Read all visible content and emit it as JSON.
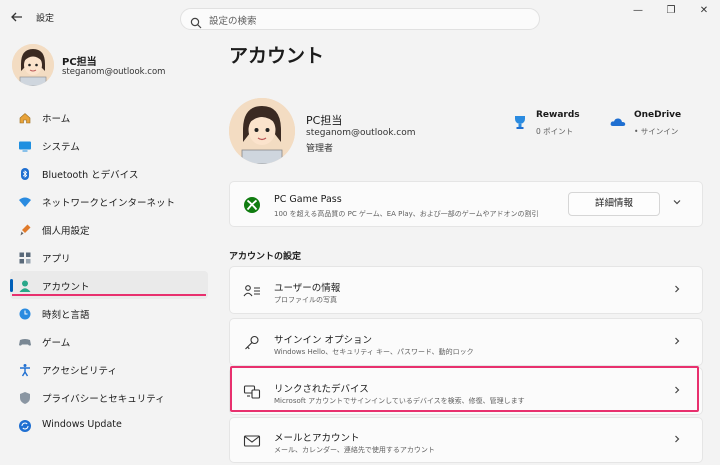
{
  "window": {
    "back_icon": "back-arrow-icon",
    "title": "設定",
    "search_placeholder": "設定の検索",
    "minimize": "—",
    "maximize": "❐",
    "close": "✕"
  },
  "profile": {
    "name": "PC担当",
    "email": "steganom@outlook.com"
  },
  "sidebar": {
    "items": [
      {
        "label": "ホーム",
        "icon": "home-icon"
      },
      {
        "label": "システム",
        "icon": "system-icon"
      },
      {
        "label": "Bluetooth とデバイス",
        "icon": "bluetooth-icon"
      },
      {
        "label": "ネットワークとインターネット",
        "icon": "network-icon"
      },
      {
        "label": "個人用設定",
        "icon": "personalization-icon"
      },
      {
        "label": "アプリ",
        "icon": "apps-icon"
      },
      {
        "label": "アカウント",
        "icon": "account-icon",
        "selected": true
      },
      {
        "label": "時刻と言語",
        "icon": "time-language-icon"
      },
      {
        "label": "ゲーム",
        "icon": "gaming-icon"
      },
      {
        "label": "アクセシビリティ",
        "icon": "accessibility-icon"
      },
      {
        "label": "プライバシーとセキュリティ",
        "icon": "privacy-shield-icon"
      },
      {
        "label": "Windows Update",
        "icon": "windows-update-icon"
      }
    ]
  },
  "main": {
    "title": "アカウント",
    "hero": {
      "name": "PC担当",
      "email": "steganom@outlook.com",
      "role": "管理者"
    },
    "rewards": {
      "title": "Rewards",
      "status": "0 ポイント"
    },
    "onedrive": {
      "title": "OneDrive",
      "status": "• サインイン"
    },
    "gamepass": {
      "title": "PC Game Pass",
      "desc": "100 を超える高品質の PC ゲーム、EA Play、および一部のゲームやアドオンの割引",
      "button": "詳細情報"
    },
    "section_heading": "アカウントの設定",
    "settings": [
      {
        "title": "ユーザーの情報",
        "desc": "プロファイルの写真",
        "icon": "user-info-icon"
      },
      {
        "title": "サインイン オプション",
        "desc": "Windows Hello、セキュリティ キー、パスワード、動的ロック",
        "icon": "key-icon"
      },
      {
        "title": "リンクされたデバイス",
        "desc": "Microsoft アカウントでサインインしているデバイスを検索、修復、管理します",
        "icon": "linked-devices-icon"
      },
      {
        "title": "メールとアカウント",
        "desc": "メール、カレンダー、連絡先で使用するアカウント",
        "icon": "mail-icon"
      }
    ]
  },
  "colors": {
    "accent": "#005fb8",
    "highlight": "#e8306e",
    "xbox_green": "#107c10"
  }
}
